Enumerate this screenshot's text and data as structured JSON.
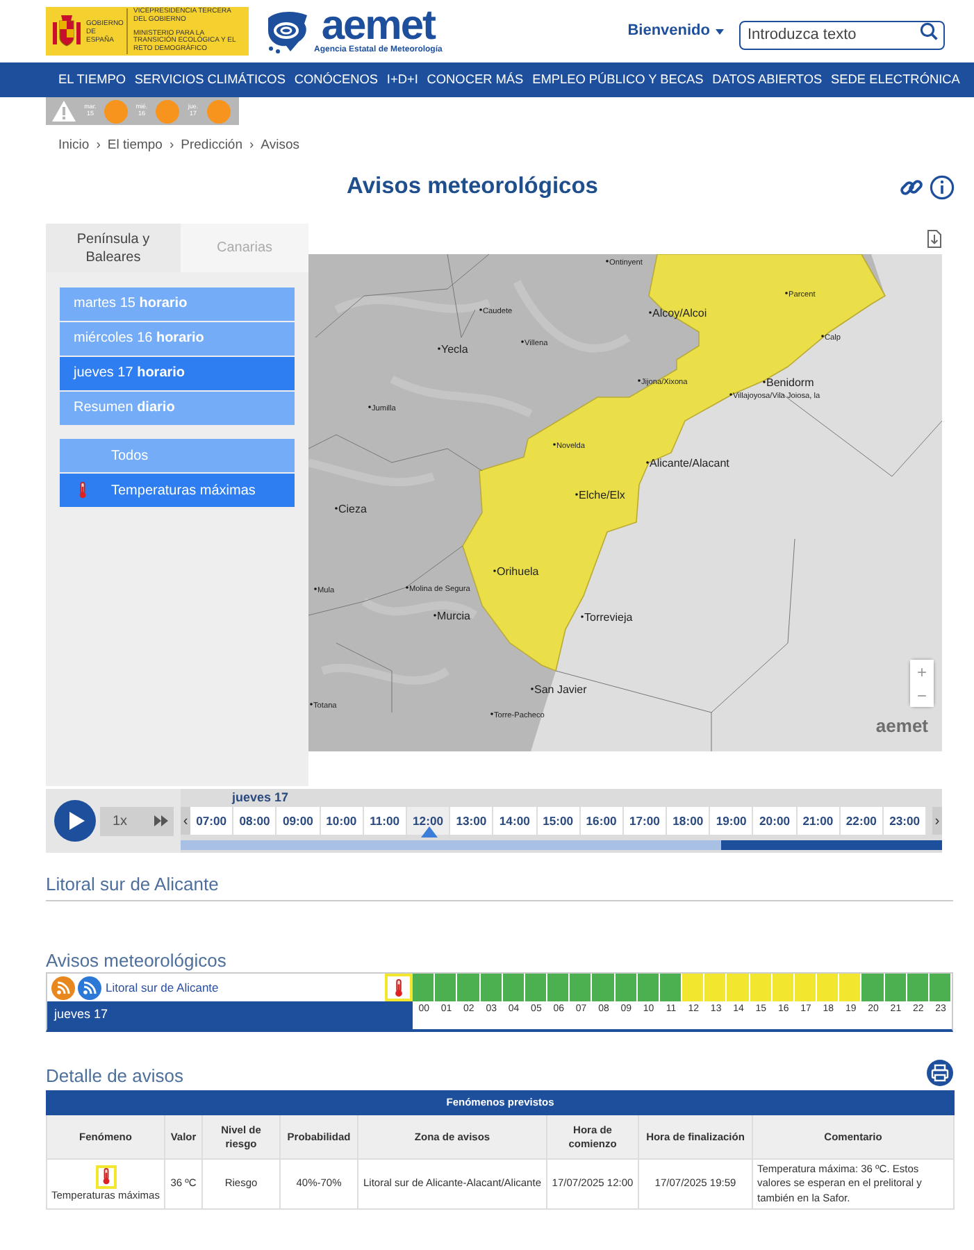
{
  "header": {
    "gov_logo": {
      "country": "GOBIERNO DE ESPAÑA",
      "lines": [
        "VICEPRESIDENCIA TERCERA DEL GOBIERNO",
        "MINISTERIO PARA LA TRANSICIÓN ECOLÓGICA Y EL RETO DEMOGRÁFICO"
      ]
    },
    "brand": {
      "name": "aemet",
      "subtitle": "Agencia Estatal de Meteorología"
    },
    "user_menu": "Bienvenido",
    "search": {
      "placeholder": "Introduzca texto"
    }
  },
  "nav": [
    "EL TIEMPO",
    "SERVICIOS CLIMÁTICOS",
    "CONÓCENOS",
    "I+D+I",
    "CONOCER MÁS",
    "EMPLEO PÚBLICO Y BECAS",
    "DATOS ABIERTOS",
    "SEDE ELECTRÓNICA"
  ],
  "warning_days": [
    {
      "weekday": "mar.",
      "day": "15",
      "color": "#f7941d"
    },
    {
      "weekday": "mié.",
      "day": "16",
      "color": "#f7941d"
    },
    {
      "weekday": "jue.",
      "day": "17",
      "color": "#f7941d"
    }
  ],
  "breadcrumb": {
    "separator": "›",
    "items": [
      "Inicio",
      "El tiempo",
      "Predicción",
      "Avisos"
    ]
  },
  "title": "Avisos meteorológicos",
  "region_tabs": [
    {
      "label": "Península y Baleares",
      "selected": true
    },
    {
      "label": "Canarias",
      "selected": false
    }
  ],
  "days": [
    {
      "label": "martes 15 **horario**",
      "selected": false
    },
    {
      "label": "miércoles 16 **horario**",
      "selected": false
    },
    {
      "label": "jueves 17 **horario**",
      "selected": true
    },
    {
      "label": "Resumen **diario**",
      "selected": false
    }
  ],
  "filters": [
    {
      "label": "Todos",
      "kind": "all"
    },
    {
      "label": "Temperaturas máximas",
      "kind": "temperature"
    }
  ],
  "map": {
    "places": [
      {
        "name": "Ontinyent",
        "major": false
      },
      {
        "name": "Parcent",
        "major": false
      },
      {
        "name": "Caudete",
        "major": false
      },
      {
        "name": "Alcoy/Alcoi",
        "major": true
      },
      {
        "name": "Calp",
        "major": false
      },
      {
        "name": "Villena",
        "major": false
      },
      {
        "name": "Yecla",
        "major": true
      },
      {
        "name": "Jijona/Xixona",
        "major": false
      },
      {
        "name": "Benidorm",
        "major": true
      },
      {
        "name": "Villajoyosa/Vila Joiosa, la",
        "major": false
      },
      {
        "name": "Jumilla",
        "major": false
      },
      {
        "name": "Novelda",
        "major": false
      },
      {
        "name": "Alicante/Alacant",
        "major": true
      },
      {
        "name": "Elche/Elx",
        "major": true
      },
      {
        "name": "Cieza",
        "major": true
      },
      {
        "name": "Orihuela",
        "major": true
      },
      {
        "name": "Mula",
        "major": false
      },
      {
        "name": "Molina de Segura",
        "major": false
      },
      {
        "name": "Murcia",
        "major": true
      },
      {
        "name": "Torrevieja",
        "major": true
      },
      {
        "name": "San Javier",
        "major": true
      },
      {
        "name": "Totana",
        "major": false
      },
      {
        "name": "Torre-Pacheco",
        "major": false
      }
    ],
    "zoom_in": "+",
    "zoom_out": "−",
    "attribution": "aemet"
  },
  "timeline": {
    "speed": "1x",
    "day": "jueves 17",
    "prev": "‹",
    "next": "›",
    "level": 0.71,
    "hours": [
      {
        "label": "07:00",
        "selected": false
      },
      {
        "label": "08:00",
        "selected": false
      },
      {
        "label": "09:00",
        "selected": false
      },
      {
        "label": "10:00",
        "selected": false
      },
      {
        "label": "11:00",
        "selected": false
      },
      {
        "label": "12:00",
        "selected": true
      },
      {
        "label": "13:00",
        "selected": false
      },
      {
        "label": "14:00",
        "selected": false
      },
      {
        "label": "15:00",
        "selected": false
      },
      {
        "label": "16:00",
        "selected": false
      },
      {
        "label": "17:00",
        "selected": false
      },
      {
        "label": "18:00",
        "selected": false
      },
      {
        "label": "19:00",
        "selected": false
      },
      {
        "label": "20:00",
        "selected": false
      },
      {
        "label": "21:00",
        "selected": false
      },
      {
        "label": "22:00",
        "selected": false
      },
      {
        "label": "23:00",
        "selected": false
      }
    ]
  },
  "zone_heading": "Litoral sur de Alicante",
  "avisos": {
    "heading": "Avisos meteorológicos",
    "zone": "Litoral sur de Alicante",
    "day": "jueves 17",
    "hours": [
      {
        "label": "00",
        "color": "#4caf50"
      },
      {
        "label": "01",
        "color": "#4caf50"
      },
      {
        "label": "02",
        "color": "#4caf50"
      },
      {
        "label": "03",
        "color": "#4caf50"
      },
      {
        "label": "04",
        "color": "#4caf50"
      },
      {
        "label": "05",
        "color": "#4caf50"
      },
      {
        "label": "06",
        "color": "#4caf50"
      },
      {
        "label": "07",
        "color": "#4caf50"
      },
      {
        "label": "08",
        "color": "#4caf50"
      },
      {
        "label": "09",
        "color": "#4caf50"
      },
      {
        "label": "10",
        "color": "#4caf50"
      },
      {
        "label": "11",
        "color": "#4caf50"
      },
      {
        "label": "12",
        "color": "#f2e62e"
      },
      {
        "label": "13",
        "color": "#f2e62e"
      },
      {
        "label": "14",
        "color": "#f2e62e"
      },
      {
        "label": "15",
        "color": "#f2e62e"
      },
      {
        "label": "16",
        "color": "#f2e62e"
      },
      {
        "label": "17",
        "color": "#f2e62e"
      },
      {
        "label": "18",
        "color": "#f2e62e"
      },
      {
        "label": "19",
        "color": "#f2e62e"
      },
      {
        "label": "20",
        "color": "#4caf50"
      },
      {
        "label": "21",
        "color": "#4caf50"
      },
      {
        "label": "22",
        "color": "#4caf50"
      },
      {
        "label": "23",
        "color": "#4caf50"
      }
    ]
  },
  "detail": {
    "heading": "Detalle de avisos",
    "table": {
      "title": "Fenómenos previstos",
      "columns": [
        "Fenómeno",
        "Valor",
        "Nivel de riesgo",
        "Probabilidad",
        "Zona de avisos",
        "Hora de comienzo",
        "Hora de finalización",
        "Comentario"
      ],
      "rows": [
        {
          "kind": "temperature",
          "cells": [
            "Temperaturas máximas",
            "36 ºC",
            "Riesgo",
            "40%-70%",
            "Litoral sur de Alicante-Alacant/Alicante",
            "17/07/2025 12:00",
            "17/07/2025 19:59",
            "Temperatura máxima: 36 ºC. Estos valores se esperan en el prelitoral y también en la Safor."
          ]
        }
      ]
    }
  }
}
